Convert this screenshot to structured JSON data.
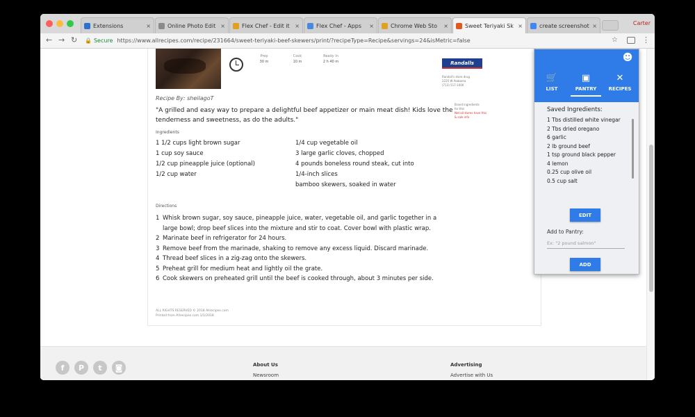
{
  "browser": {
    "tabs": [
      {
        "label": "Extensions",
        "favicon_color": "#2f6fd0"
      },
      {
        "label": "Online Photo Edit",
        "favicon_color": "#8a8a8a"
      },
      {
        "label": "Flex Chef - Edit it",
        "favicon_color": "#e0a020"
      },
      {
        "label": "Flex Chef - Apps",
        "favicon_color": "#4a88e0"
      },
      {
        "label": "Chrome Web Sto",
        "favicon_color": "#e0a020"
      },
      {
        "label": "Sweet Teriyaki Sk",
        "favicon_color": "#e05a20"
      },
      {
        "label": "create screenshot",
        "favicon_color": "#4285f4"
      }
    ],
    "active_tab_index": 5,
    "profile_name": "Carter",
    "secure_label": "Secure",
    "url": "https://www.allrecipes.com/recipe/231664/sweet-teriyaki-beef-skewers/print/?recipeType=Recipe&servings=24&isMetric=false"
  },
  "recipe": {
    "times": [
      {
        "label": "Prep",
        "value": "30 m"
      },
      {
        "label": "Cook",
        "value": "10 m"
      },
      {
        "label": "Ready In",
        "value": "2 h 40 m"
      }
    ],
    "store": {
      "logo": "Randalls",
      "info": "Randall's store drug\n2225 W Alabama\n(713) 517-1000",
      "note": "Brand ingredients\nfor this",
      "note_red": "Not all stores have this\n& sale info"
    },
    "byline": "Recipe By: sheilagoT",
    "description": "\"A grilled and easy way to prepare a delightful beef appetizer or main meat dish! Kids love the tenderness and sweetness, as do the adults.\"",
    "ingredients_heading": "Ingredients",
    "ingredients_left": [
      "1 1/2 cups light brown sugar",
      "1 cup soy sauce",
      "1/2 cup pineapple juice (optional)",
      "1/2 cup water"
    ],
    "ingredients_right": [
      "1/4 cup vegetable oil",
      "3 large garlic cloves, chopped",
      "4 pounds boneless round steak, cut into",
      "1/4-inch slices",
      "bamboo skewers, soaked in water"
    ],
    "directions_heading": "Directions",
    "directions": [
      "Whisk brown sugar, soy sauce, pineapple juice, water, vegetable oil, and garlic together in a large bowl; drop beef slices into the mixture and stir to coat. Cover bowl with plastic wrap.",
      "Marinate beef in refrigerator for 24 hours.",
      "Remove beef from the marinade, shaking to remove any excess liquid. Discard marinade.",
      "Thread beef slices in a zig-zag onto the skewers.",
      "Preheat grill for medium heat and lightly oil the grate.",
      "Cook skewers on preheated grill until the beef is cooked through, about 3 minutes per side."
    ],
    "footnote": "ALL RIGHTS RESERVED © 2018 Allrecipes.com\nPrinted from Allrecipes.com 1/1/2018"
  },
  "footer": {
    "social_icons": [
      "f",
      "P",
      "t",
      "◙"
    ],
    "col1_heading": "About Us",
    "col1_link": "Newsroom",
    "col2_heading": "Advertising",
    "col2_link": "Advertise with Us"
  },
  "extension": {
    "tabs": [
      {
        "label": "LIST",
        "icon": "cart-icon"
      },
      {
        "label": "PANTRY",
        "icon": "pantry-icon"
      },
      {
        "label": "RECIPES",
        "icon": "utensils-icon"
      }
    ],
    "active_tab_index": 1,
    "saved_title": "Saved Ingredients:",
    "saved_ingredients": [
      "1 Tbs distilled white vinegar",
      "2 Tbs dried oregano",
      "6 garlic",
      "2 lb ground beef",
      "1 tsp ground black pepper",
      "4 lemon",
      "0.25 cup olive oil",
      "0.5 cup salt"
    ],
    "edit_label": "EDIT",
    "add_label": "Add to Pantry:",
    "add_placeholder": "Ex: \"2 pound salmon\"",
    "add_button": "ADD",
    "accent_color": "#2f7ce8"
  }
}
